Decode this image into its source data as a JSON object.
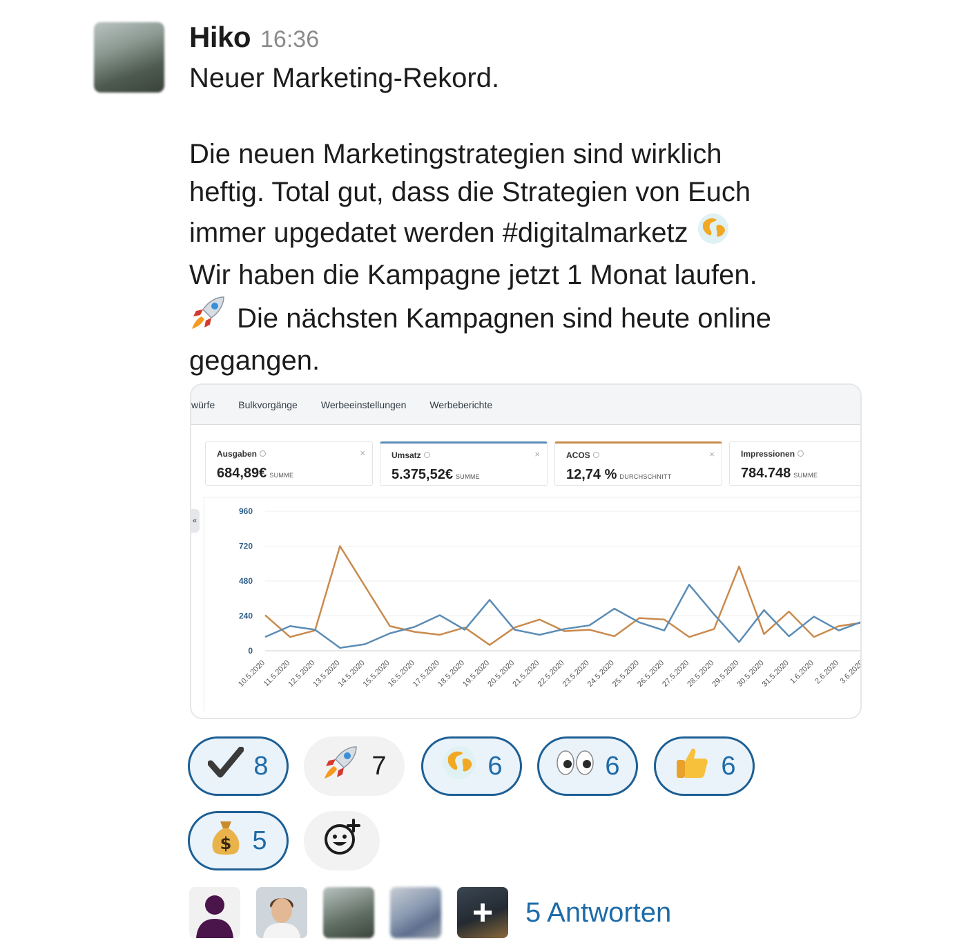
{
  "message": {
    "sender": "Hiko",
    "time": "16:36",
    "lines": [
      "Neuer Marketing-Rekord.",
      "Die neuen Marketingstrategien sind wirklich",
      "heftig. Total gut, dass die Strategien von Euch",
      "immer upgedatet werden #digitalmarketz",
      "Wir haben die Kampagne jetzt 1 Monat laufen.",
      "Die nächsten Kampagnen sind heute online",
      "gegangen."
    ]
  },
  "card": {
    "nav": [
      "würfe",
      "Bulkvorgänge",
      "Werbeeinstellungen",
      "Werbeberichte"
    ],
    "collapse_label": "«",
    "metrics": [
      {
        "label": "Ausgaben",
        "value": "684,89€",
        "unit": "SUMME"
      },
      {
        "label": "Umsatz",
        "value": "5.375,52€",
        "unit": "SUMME"
      },
      {
        "label": "ACOS",
        "value": "12,74 %",
        "unit": "DURCHSCHNITT"
      },
      {
        "label": "Impressionen",
        "value": "784.748",
        "unit": "SUMME"
      }
    ],
    "close_glyph": "×"
  },
  "chart_data": {
    "type": "line",
    "categories": [
      "10.5.2020",
      "11.5.2020",
      "12.5.2020",
      "13.5.2020",
      "14.5.2020",
      "15.5.2020",
      "16.5.2020",
      "17.5.2020",
      "18.5.2020",
      "19.5.2020",
      "20.5.2020",
      "21.5.2020",
      "22.5.2020",
      "23.5.2020",
      "24.5.2020",
      "25.5.2020",
      "26.5.2020",
      "27.5.2020",
      "28.5.2020",
      "29.5.2020",
      "30.5.2020",
      "31.5.2020",
      "1.6.2020",
      "2.6.2020",
      "3.6.2020"
    ],
    "yticks": [
      0,
      240,
      480,
      720,
      960
    ],
    "ylim": [
      0,
      960
    ],
    "series": [
      {
        "color": "#c98a4d",
        "values": [
          245,
          95,
          140,
          720,
          445,
          170,
          130,
          110,
          160,
          40,
          160,
          215,
          135,
          145,
          100,
          225,
          215,
          95,
          150,
          580,
          115,
          270,
          95,
          170,
          195
        ]
      },
      {
        "color": "#5b8cb5",
        "values": [
          95,
          170,
          145,
          20,
          45,
          120,
          165,
          245,
          145,
          350,
          145,
          110,
          150,
          175,
          290,
          195,
          140,
          455,
          250,
          60,
          280,
          100,
          235,
          140,
          205
        ]
      }
    ],
    "grid": true,
    "legend": "none"
  },
  "reactions": [
    {
      "icon": "check-icon",
      "count": "8",
      "selected": true
    },
    {
      "icon": "rocket-icon",
      "count": "7",
      "selected": false
    },
    {
      "icon": "globe-icon",
      "count": "6",
      "selected": true
    },
    {
      "icon": "eyes-icon",
      "count": "6",
      "selected": true
    },
    {
      "icon": "thumbs-up-icon",
      "count": "6",
      "selected": true
    },
    {
      "icon": "money-bag-icon",
      "count": "5",
      "selected": true
    },
    {
      "icon": "add-reaction-icon",
      "count": "",
      "selected": false
    }
  ],
  "thread": {
    "plus_glyph": "+",
    "replies_label": "5 Antworten"
  },
  "colors": {
    "link": "#1d6ba8",
    "reaction_border": "#1d5f94",
    "reaction_bg": "#eaf2fa",
    "series_orange": "#c98a4d",
    "series_blue": "#5b8cb5"
  }
}
